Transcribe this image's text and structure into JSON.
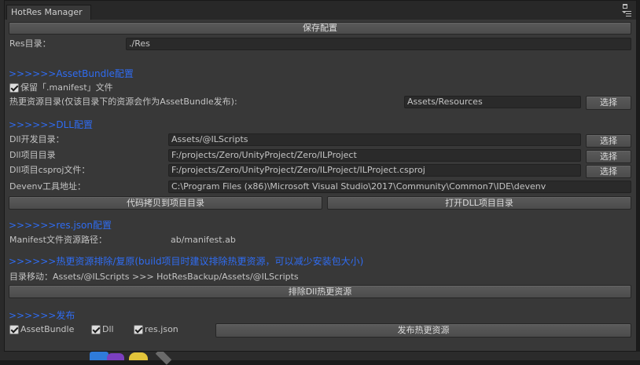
{
  "window": {
    "tab_title": "HotRes Manager"
  },
  "toolbar": {
    "save_config": "保存配置"
  },
  "res_dir": {
    "label": "Res目录：",
    "value": "./Res"
  },
  "assetbundle": {
    "header": ">>>>>>AssetBundle配置",
    "keep_manifest_label": "保留「.manifest」文件",
    "keep_manifest_checked": true,
    "hot_dir_label": "热更资源目录(仅该目录下的资源会作为AssetBundle发布):",
    "hot_dir_value": "Assets/Resources",
    "choose": "选择"
  },
  "dll": {
    "header": ">>>>>>DLL配置",
    "rows": [
      {
        "label": "Dll开发目录：",
        "value": "Assets/@ILScripts",
        "button": "选择"
      },
      {
        "label": "Dll项目目录",
        "value": "F:/projects/Zero/UnityProject/Zero/ILProject",
        "button": "选择"
      },
      {
        "label": "Dll项目csproj文件：",
        "value": "F:/projects/Zero/UnityProject/Zero/ILProject/ILProject.csproj",
        "button": "选择"
      },
      {
        "label": "Devenv工具地址：",
        "value": "C:\\Program Files (x86)\\Microsoft Visual Studio\\2017\\Community\\Common7\\IDE\\devenv",
        "button": ""
      }
    ],
    "copy_code": "代码拷贝到项目目录",
    "open_project": "打开DLL项目目录"
  },
  "resjson": {
    "header": ">>>>>>res.json配置",
    "manifest_label": "Manifest文件资源路径：",
    "manifest_value": "ab/manifest.ab"
  },
  "exclude": {
    "header": ">>>>>>热更资源排除/复原(build项目时建议排除热更资源，可以减少安装包大小)",
    "move_text": "目录移动：Assets/@ILScripts >>> HotResBackup/Assets/@ILScripts",
    "button": "排除Dll热更资源"
  },
  "publish": {
    "header": ">>>>>>发布",
    "options": [
      {
        "label": "AssetBundle",
        "checked": true
      },
      {
        "label": "Dll",
        "checked": true
      },
      {
        "label": "res.json",
        "checked": true
      }
    ],
    "button": "发布热更资源"
  },
  "colors": {
    "header": "#2f6cf2",
    "panel": "#383838",
    "field": "#2a2a2a"
  }
}
